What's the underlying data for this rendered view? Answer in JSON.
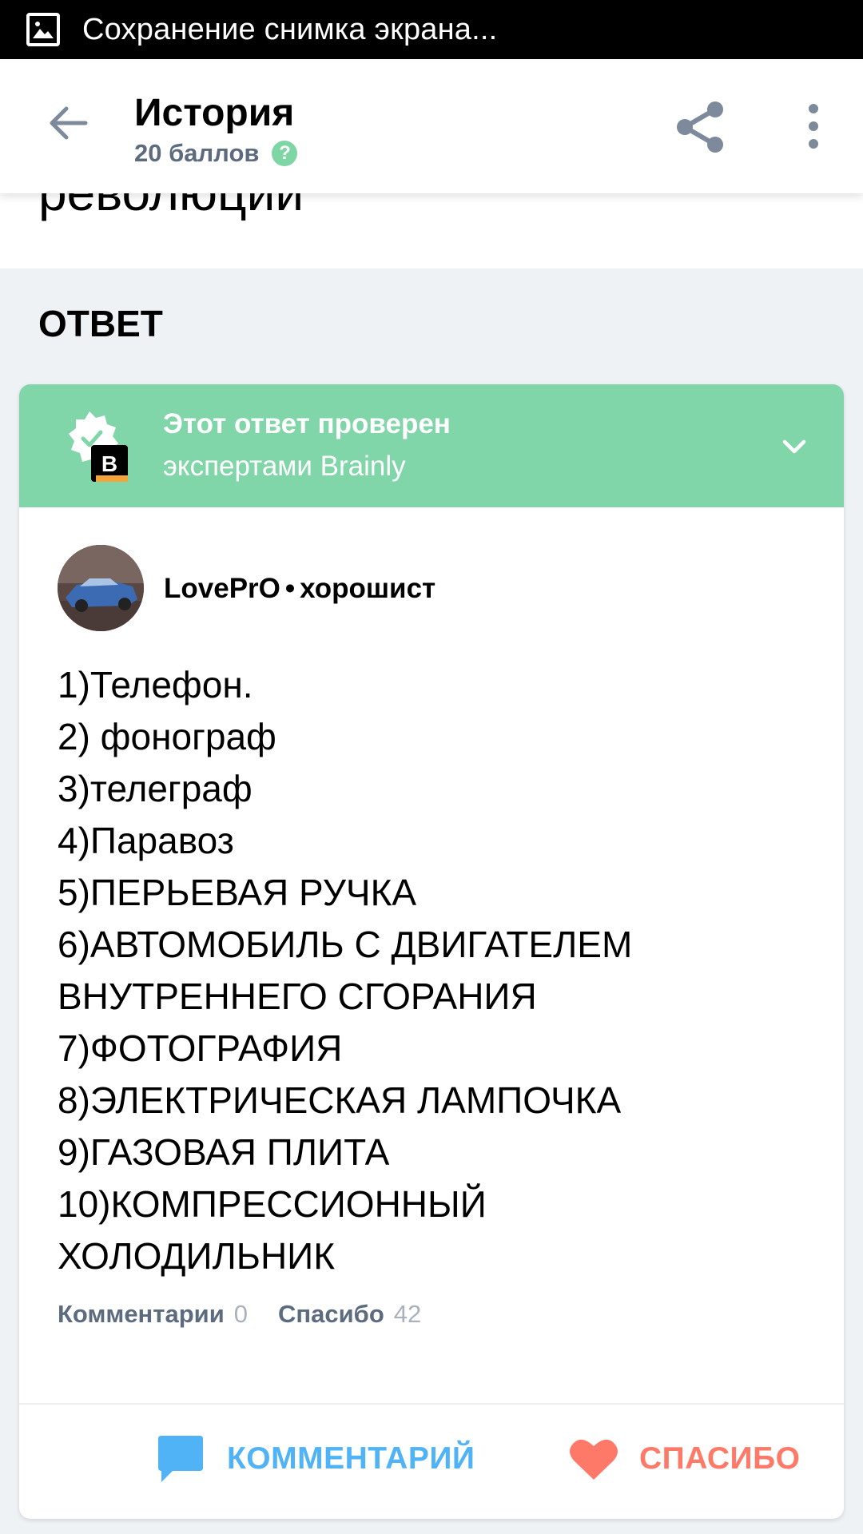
{
  "status_bar": {
    "notification_text": "Сохранение снимка экрана...",
    "icon": "screenshot-icon"
  },
  "header": {
    "title": "История",
    "points": "20 баллов",
    "help_icon_glyph": "?",
    "back_icon": "arrow-left-icon",
    "share_icon": "share-icon",
    "more_icon": "more-vertical-icon"
  },
  "question": {
    "visible_text": "революции"
  },
  "answer_section": {
    "heading": "ОТВЕТ"
  },
  "verified": {
    "title": "Этот ответ проверен",
    "subtitle": "экспертами Brainly",
    "badge_letter": "B",
    "color": "#81d6a9"
  },
  "author": {
    "name": "LovePrO",
    "separator": "•",
    "rank": "хорошист"
  },
  "answer": {
    "lines": [
      "1)Телефон.",
      "2) фонограф",
      "3)телеграф",
      "4)Паравоз",
      "5)ПЕРЬЕВАЯ РУЧКА",
      "6)АВТОМОБИЛЬ С ДВИГАТЕЛЕМ",
      "ВНУТРЕННЕГО СГОРАНИЯ",
      "7)ФОТОГРАФИЯ",
      "8)ЭЛЕКТРИЧЕСКАЯ ЛАМПОЧКА",
      "9)ГАЗОВАЯ ПЛИТА",
      "10)КОМПРЕССИОННЫЙ",
      "ХОЛОДИЛЬНИК"
    ]
  },
  "stats": {
    "comments_label": "Комментарии",
    "comments_count": "0",
    "thanks_label": "Спасибо",
    "thanks_count": "42"
  },
  "actions": {
    "comment_label": "КОММЕНТАРИЙ",
    "comment_icon": "speech-bubble-icon",
    "comment_color": "#4fb3f6",
    "thanks_label": "СПАСИБО",
    "thanks_icon": "heart-icon",
    "thanks_color": "#ff7968"
  }
}
